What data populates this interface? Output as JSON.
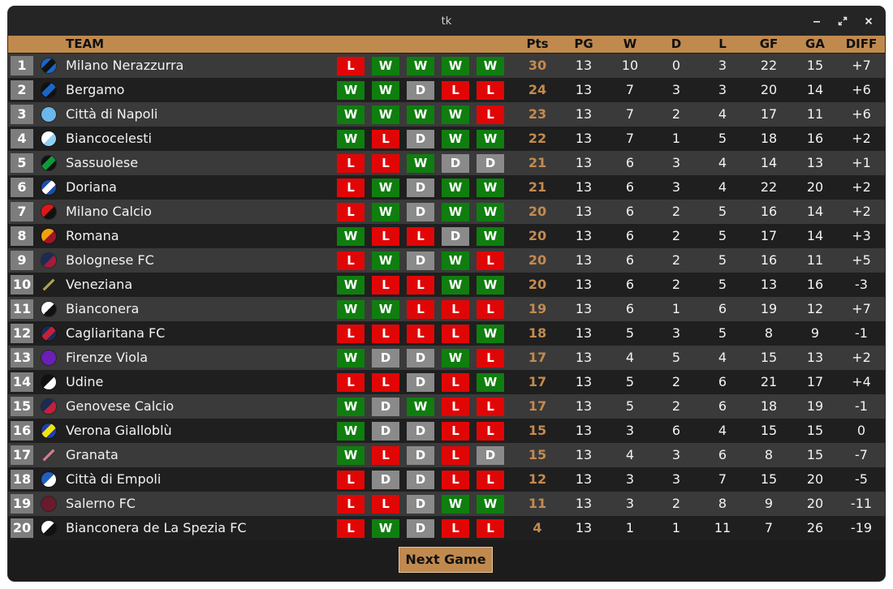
{
  "window": {
    "title": "tk"
  },
  "header": {
    "team": "TEAM",
    "pts": "Pts",
    "pg": "PG",
    "w": "W",
    "d": "D",
    "l": "L",
    "gf": "GF",
    "ga": "GA",
    "diff": "DIFF"
  },
  "colors": {
    "win": "#0f7e0f",
    "loss": "#e10606",
    "draw": "#8a8a8a",
    "accent": "#c08a4e",
    "points": "#c48a4f"
  },
  "standings": [
    {
      "pos": "1",
      "team": "Milano Nerazzurra",
      "form": [
        "L",
        "W",
        "W",
        "W",
        "W"
      ],
      "pts": "30",
      "pg": "13",
      "w": "10",
      "d": "0",
      "l": "3",
      "gf": "22",
      "ga": "15",
      "diff": "+7",
      "logo": {
        "c1": "#1a66c8",
        "c2": "#111111",
        "style": "stripe"
      }
    },
    {
      "pos": "2",
      "team": "Bergamo",
      "form": [
        "W",
        "W",
        "D",
        "L",
        "L"
      ],
      "pts": "24",
      "pg": "13",
      "w": "7",
      "d": "3",
      "l": "3",
      "gf": "20",
      "ga": "14",
      "diff": "+6",
      "logo": {
        "c1": "#111111",
        "c2": "#1a66c8",
        "style": "stripe"
      }
    },
    {
      "pos": "3",
      "team": "Città di Napoli",
      "form": [
        "W",
        "W",
        "W",
        "W",
        "L"
      ],
      "pts": "23",
      "pg": "13",
      "w": "7",
      "d": "2",
      "l": "4",
      "gf": "17",
      "ga": "11",
      "diff": "+6",
      "logo": {
        "c1": "#6bb6ea",
        "c2": "#6bb6ea",
        "style": "solid"
      }
    },
    {
      "pos": "4",
      "team": "Biancocelesti",
      "form": [
        "W",
        "L",
        "D",
        "W",
        "W"
      ],
      "pts": "22",
      "pg": "13",
      "w": "7",
      "d": "1",
      "l": "5",
      "gf": "18",
      "ga": "16",
      "diff": "+2",
      "logo": {
        "c1": "#ffffff",
        "c2": "#8fd0f2",
        "style": "half"
      }
    },
    {
      "pos": "5",
      "team": "Sassuolese",
      "form": [
        "L",
        "L",
        "W",
        "D",
        "D"
      ],
      "pts": "21",
      "pg": "13",
      "w": "6",
      "d": "3",
      "l": "4",
      "gf": "14",
      "ga": "13",
      "diff": "+1",
      "logo": {
        "c1": "#111111",
        "c2": "#0f9a3a",
        "style": "stripe"
      }
    },
    {
      "pos": "6",
      "team": "Doriana",
      "form": [
        "L",
        "W",
        "D",
        "W",
        "W"
      ],
      "pts": "21",
      "pg": "13",
      "w": "6",
      "d": "3",
      "l": "4",
      "gf": "22",
      "ga": "20",
      "diff": "+2",
      "logo": {
        "c1": "#1e4ea8",
        "c2": "#ffffff",
        "style": "stripe"
      }
    },
    {
      "pos": "7",
      "team": "Milano Calcio",
      "form": [
        "L",
        "W",
        "D",
        "W",
        "W"
      ],
      "pts": "20",
      "pg": "13",
      "w": "6",
      "d": "2",
      "l": "5",
      "gf": "16",
      "ga": "14",
      "diff": "+2",
      "logo": {
        "c1": "#e01515",
        "c2": "#111111",
        "style": "half"
      }
    },
    {
      "pos": "8",
      "team": "Romana",
      "form": [
        "W",
        "L",
        "L",
        "D",
        "W"
      ],
      "pts": "20",
      "pg": "13",
      "w": "6",
      "d": "2",
      "l": "5",
      "gf": "17",
      "ga": "14",
      "diff": "+3",
      "logo": {
        "c1": "#f0a20a",
        "c2": "#9c1528",
        "style": "half"
      }
    },
    {
      "pos": "9",
      "team": "Bolognese FC",
      "form": [
        "L",
        "W",
        "D",
        "W",
        "L"
      ],
      "pts": "20",
      "pg": "13",
      "w": "6",
      "d": "2",
      "l": "5",
      "gf": "16",
      "ga": "11",
      "diff": "+5",
      "logo": {
        "c1": "#1a2b55",
        "c2": "#a31c3a",
        "style": "half"
      }
    },
    {
      "pos": "10",
      "team": "Veneziana",
      "form": [
        "W",
        "L",
        "L",
        "W",
        "W"
      ],
      "pts": "20",
      "pg": "13",
      "w": "6",
      "d": "2",
      "l": "5",
      "gf": "13",
      "ga": "16",
      "diff": "-3",
      "logo": {
        "c1": "#1f1f1f",
        "c2": "#b0a050",
        "style": "line"
      }
    },
    {
      "pos": "11",
      "team": "Bianconera",
      "form": [
        "W",
        "W",
        "L",
        "L",
        "L"
      ],
      "pts": "19",
      "pg": "13",
      "w": "6",
      "d": "1",
      "l": "6",
      "gf": "19",
      "ga": "12",
      "diff": "+7",
      "logo": {
        "c1": "#ffffff",
        "c2": "#111111",
        "style": "half"
      }
    },
    {
      "pos": "12",
      "team": "Cagliaritana FC",
      "form": [
        "L",
        "L",
        "L",
        "L",
        "W"
      ],
      "pts": "18",
      "pg": "13",
      "w": "5",
      "d": "3",
      "l": "5",
      "gf": "8",
      "ga": "9",
      "diff": "-1",
      "logo": {
        "c1": "#1a2b55",
        "c2": "#c4203c",
        "style": "stripe"
      }
    },
    {
      "pos": "13",
      "team": "Firenze Viola",
      "form": [
        "W",
        "D",
        "D",
        "W",
        "L"
      ],
      "pts": "17",
      "pg": "13",
      "w": "4",
      "d": "5",
      "l": "4",
      "gf": "15",
      "ga": "13",
      "diff": "+2",
      "logo": {
        "c1": "#6a1fb5",
        "c2": "#6a1fb5",
        "style": "solid"
      }
    },
    {
      "pos": "14",
      "team": "Udine",
      "form": [
        "L",
        "L",
        "D",
        "L",
        "W"
      ],
      "pts": "17",
      "pg": "13",
      "w": "5",
      "d": "2",
      "l": "6",
      "gf": "21",
      "ga": "17",
      "diff": "+4",
      "logo": {
        "c1": "#111111",
        "c2": "#ffffff",
        "style": "half"
      }
    },
    {
      "pos": "15",
      "team": "Genovese Calcio",
      "form": [
        "W",
        "D",
        "W",
        "L",
        "L"
      ],
      "pts": "17",
      "pg": "13",
      "w": "5",
      "d": "2",
      "l": "6",
      "gf": "18",
      "ga": "19",
      "diff": "-1",
      "logo": {
        "c1": "#1a2b55",
        "c2": "#c4203c",
        "style": "half"
      }
    },
    {
      "pos": "16",
      "team": "Verona Gialloblù",
      "form": [
        "W",
        "D",
        "D",
        "L",
        "L"
      ],
      "pts": "15",
      "pg": "13",
      "w": "3",
      "d": "6",
      "l": "4",
      "gf": "15",
      "ga": "15",
      "diff": "0",
      "logo": {
        "c1": "#1e3fae",
        "c2": "#f3e40a",
        "style": "stripe"
      }
    },
    {
      "pos": "17",
      "team": "Granata",
      "form": [
        "W",
        "L",
        "D",
        "L",
        "D"
      ],
      "pts": "15",
      "pg": "13",
      "w": "4",
      "d": "3",
      "l": "6",
      "gf": "8",
      "ga": "15",
      "diff": "-7",
      "logo": {
        "c1": "#7a1f26",
        "c2": "#d08090",
        "style": "line"
      }
    },
    {
      "pos": "18",
      "team": "Città di Empoli",
      "form": [
        "L",
        "D",
        "D",
        "L",
        "L"
      ],
      "pts": "12",
      "pg": "13",
      "w": "3",
      "d": "3",
      "l": "7",
      "gf": "15",
      "ga": "20",
      "diff": "-5",
      "logo": {
        "c1": "#1f5fbf",
        "c2": "#ffffff",
        "style": "half"
      }
    },
    {
      "pos": "19",
      "team": "Salerno FC",
      "form": [
        "L",
        "L",
        "D",
        "W",
        "W"
      ],
      "pts": "11",
      "pg": "13",
      "w": "3",
      "d": "2",
      "l": "8",
      "gf": "9",
      "ga": "20",
      "diff": "-11",
      "logo": {
        "c1": "#6a1a2c",
        "c2": "#6a1a2c",
        "style": "solid"
      }
    },
    {
      "pos": "20",
      "team": "Bianconera de La Spezia FC",
      "form": [
        "L",
        "W",
        "D",
        "L",
        "L"
      ],
      "pts": "4",
      "pg": "13",
      "w": "1",
      "d": "1",
      "l": "11",
      "gf": "7",
      "ga": "26",
      "diff": "-19",
      "logo": {
        "c1": "#ffffff",
        "c2": "#111111",
        "style": "half"
      }
    }
  ],
  "footer": {
    "next_label": "Next Game"
  }
}
